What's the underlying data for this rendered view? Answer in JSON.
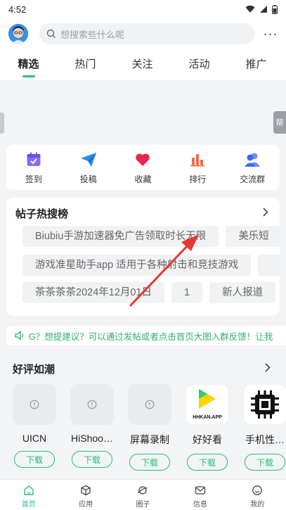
{
  "status_bar": {
    "time": "4:52"
  },
  "header": {
    "search_placeholder": "想搜索些什么呢",
    "more_label": "···"
  },
  "tabs": [
    {
      "label": "精选",
      "active": true
    },
    {
      "label": "热门",
      "active": false
    },
    {
      "label": "关注",
      "active": false
    },
    {
      "label": "活动",
      "active": false
    },
    {
      "label": "推广",
      "active": false
    }
  ],
  "side_tab_right": "帮",
  "quick_actions": [
    {
      "label": "签到",
      "icon": "calendar-icon"
    },
    {
      "label": "投稿",
      "icon": "paper-plane-icon"
    },
    {
      "label": "收藏",
      "icon": "heart-icon"
    },
    {
      "label": "排行",
      "icon": "bar-chart-icon"
    },
    {
      "label": "交流群",
      "icon": "group-icon"
    }
  ],
  "hot_posts": {
    "title": "帖子热搜榜",
    "rows": [
      [
        "Biubiu手游加速器免广告领取时长无限",
        "美乐短"
      ],
      [
        "游戏准星助手app 适用于各种射击和竞技游戏",
        ""
      ],
      [
        "茶茶茶茶2024年12月01日",
        "1",
        "新人报道"
      ]
    ]
  },
  "notice": {
    "text": "G？想提建议？可以通过发帖或者点击首页大图入群反馈！让我"
  },
  "good_reviews": {
    "title": "好评如潮",
    "apps": [
      {
        "name": "UICN",
        "download": "下载",
        "icon": "placeholder-icon"
      },
      {
        "name": "HiShoo…",
        "download": "下载",
        "icon": "placeholder-icon"
      },
      {
        "name": "屏幕录制",
        "download": "下载",
        "icon": "placeholder-icon"
      },
      {
        "name": "好好看",
        "download": "下载",
        "icon": "hhkan-logo-icon",
        "logo_text": "HHKAN.APP"
      },
      {
        "name": "手机性…",
        "download": "下载",
        "icon": "chip-icon"
      }
    ]
  },
  "bottom_nav": [
    {
      "label": "首页",
      "icon": "home-icon",
      "active": true
    },
    {
      "label": "应用",
      "icon": "cube-icon",
      "active": false
    },
    {
      "label": "圈子",
      "icon": "planet-icon",
      "active": false
    },
    {
      "label": "信息",
      "icon": "mail-icon",
      "active": false
    },
    {
      "label": "我的",
      "icon": "smile-icon",
      "active": false
    }
  ],
  "colors": {
    "accent": "#27c07a",
    "annotation": "#e53935"
  }
}
